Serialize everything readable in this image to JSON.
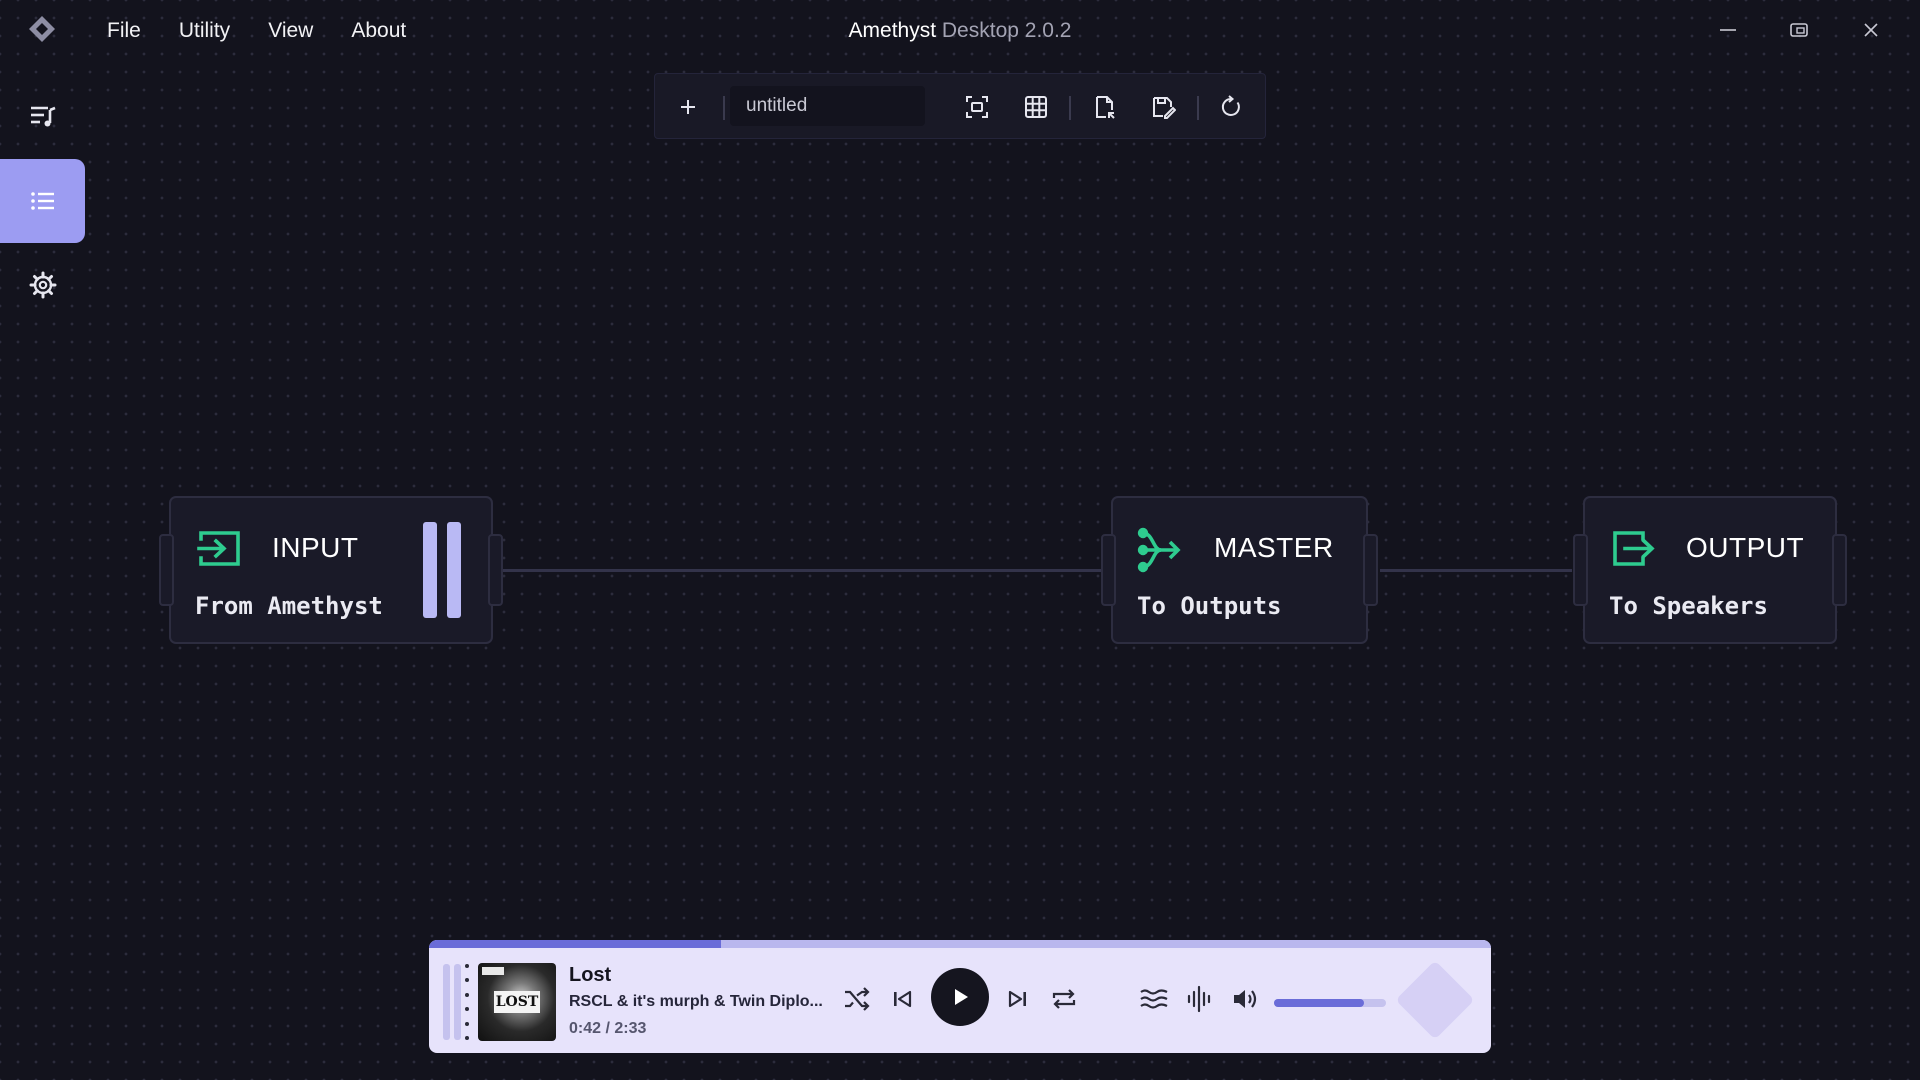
{
  "titlebar": {
    "app_name": "Amethyst",
    "app_version": "Desktop 2.0.2",
    "menu": [
      "File",
      "Utility",
      "View",
      "About"
    ]
  },
  "sidebar": {
    "items": [
      {
        "name": "playlist",
        "icon": "playlist-icon",
        "active": false
      },
      {
        "name": "list",
        "icon": "list-icon",
        "active": true
      },
      {
        "name": "settings",
        "icon": "gear-icon",
        "active": false
      }
    ],
    "active_color": "#9c9cf2"
  },
  "toolbar": {
    "filename": "untitled",
    "icons": [
      "plus-icon",
      "fit-view-icon",
      "grid-icon",
      "load-file-icon",
      "save-file-icon",
      "reset-icon"
    ]
  },
  "nodes": [
    {
      "title": "INPUT",
      "subtitle": "From Amethyst",
      "icon": "input-icon",
      "state": "paused"
    },
    {
      "title": "MASTER",
      "subtitle": "To Outputs",
      "icon": "split-icon"
    },
    {
      "title": "OUTPUT",
      "subtitle": "To Speakers",
      "icon": "output-icon"
    }
  ],
  "player": {
    "title": "Lost",
    "artist": "RSCL & it's murph & Twin Diplo...",
    "time": "0:42 / 2:33",
    "cover_text": "LOST",
    "progress": 0.275,
    "volume": 0.8,
    "controls": [
      "shuffle-icon",
      "previous-icon",
      "play-icon",
      "next-icon",
      "repeat-icon",
      "equalizer-icon",
      "waveform-icon",
      "volume-icon"
    ]
  },
  "colors": {
    "accent": "#9c9cf2",
    "node_icon": "#2ecc8f",
    "background": "#13131d",
    "player_bg": "#e7e3fb"
  }
}
